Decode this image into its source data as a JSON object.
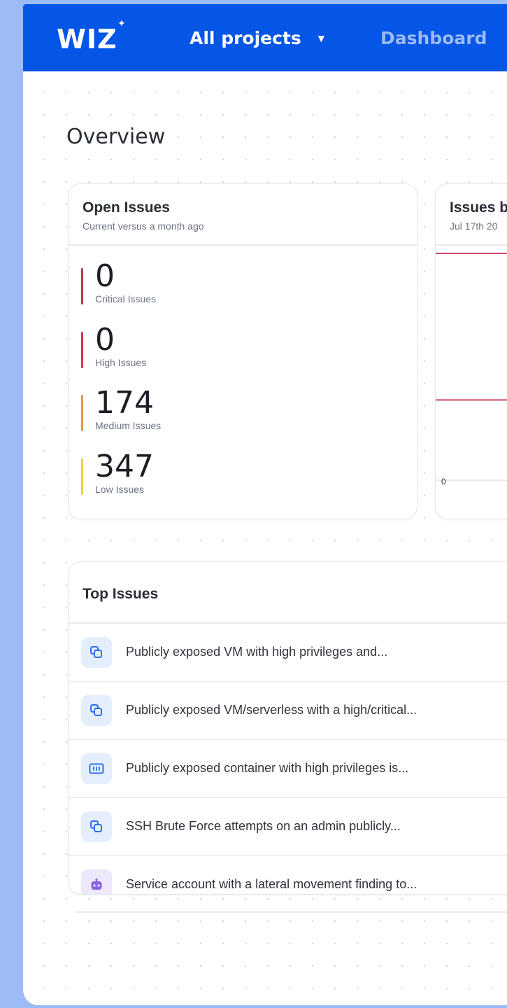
{
  "header": {
    "logo": "WIZ",
    "projects_label": "All projects",
    "dashboard_label": "Dashboard"
  },
  "page": {
    "title": "Overview"
  },
  "open_issues": {
    "title": "Open Issues",
    "subtitle": "Current versus a month ago",
    "items": [
      {
        "count": "0",
        "label": "Critical Issues",
        "color": "#b5354a"
      },
      {
        "count": "0",
        "label": "High Issues",
        "color": "#d2344f"
      },
      {
        "count": "174",
        "label": "Medium Issues",
        "color": "#e99145"
      },
      {
        "count": "347",
        "label": "Low Issues",
        "color": "#f2cd45"
      }
    ]
  },
  "issues_chart": {
    "title": "Issues b",
    "subtitle": "Jul 17th 20",
    "y_zero_label": "0"
  },
  "chart_data": {
    "type": "line",
    "title": "Issues b",
    "subtitle": "Jul 17th 20",
    "y_tick_labels": [
      "0"
    ],
    "ylim_start": 0,
    "grid": false,
    "series": [
      {
        "color": "#cf4a63",
        "values": [
          1.0,
          1.0,
          1.0,
          1.0
        ]
      },
      {
        "color": "#cf4a63",
        "values": [
          0.32,
          0.32,
          0.33,
          0.34
        ]
      }
    ]
  },
  "top_issues": {
    "title": "Top Issues",
    "rows": [
      {
        "text": "Publicly exposed VM with high privileges and...",
        "icon": "vm-copy-icon"
      },
      {
        "text": "Publicly exposed VM/serverless with a high/critical...",
        "icon": "vm-copy-icon"
      },
      {
        "text": "Publicly exposed container with high privileges is...",
        "icon": "container-icon"
      },
      {
        "text": "SSH Brute Force attempts on an admin publicly...",
        "icon": "vm-copy-icon"
      },
      {
        "text": "Service account with a lateral movement finding to...",
        "icon": "service-account-icon"
      }
    ]
  },
  "colors": {
    "brand": "#0555e6",
    "background": "#9dbcf6",
    "vm_icon_bg": "#e4eefd",
    "vm_icon_fg": "#2f6ee8",
    "service_icon_bg": "#eee8fc",
    "service_icon_fg": "#8a63dd"
  }
}
